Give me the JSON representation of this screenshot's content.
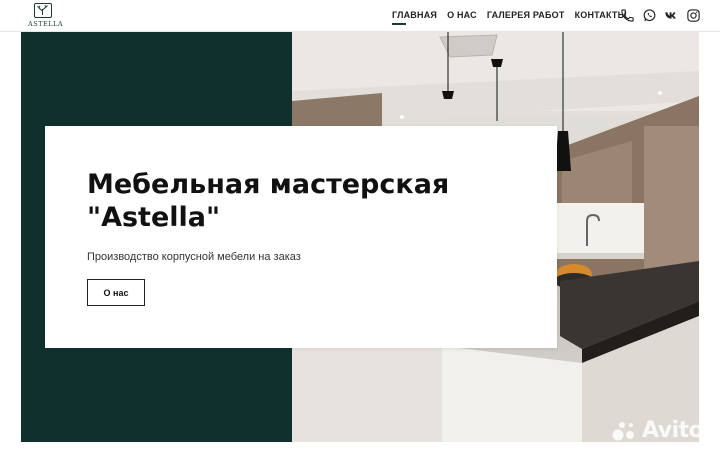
{
  "header": {
    "logo_text": "ASTELLA",
    "nav": [
      {
        "label": "ГЛАВНАЯ",
        "active": true
      },
      {
        "label": "О НАС",
        "active": false
      },
      {
        "label": "ГАЛЕРЕЯ РАБОТ",
        "active": false
      },
      {
        "label": "КОНТАКТЫ",
        "active": false
      }
    ],
    "contact_icons": [
      "phone-icon",
      "whatsapp-icon",
      "vk-icon",
      "instagram-icon"
    ]
  },
  "hero": {
    "title_line1": "Мебельная мастерская",
    "title_line2": "\"Astella\"",
    "subtitle": "Производство корпусной мебели на заказ",
    "button_label": "О нас"
  },
  "colors": {
    "accent_dark_green": "#0f302c",
    "text": "#111111"
  },
  "watermark": {
    "text": "Avito"
  }
}
